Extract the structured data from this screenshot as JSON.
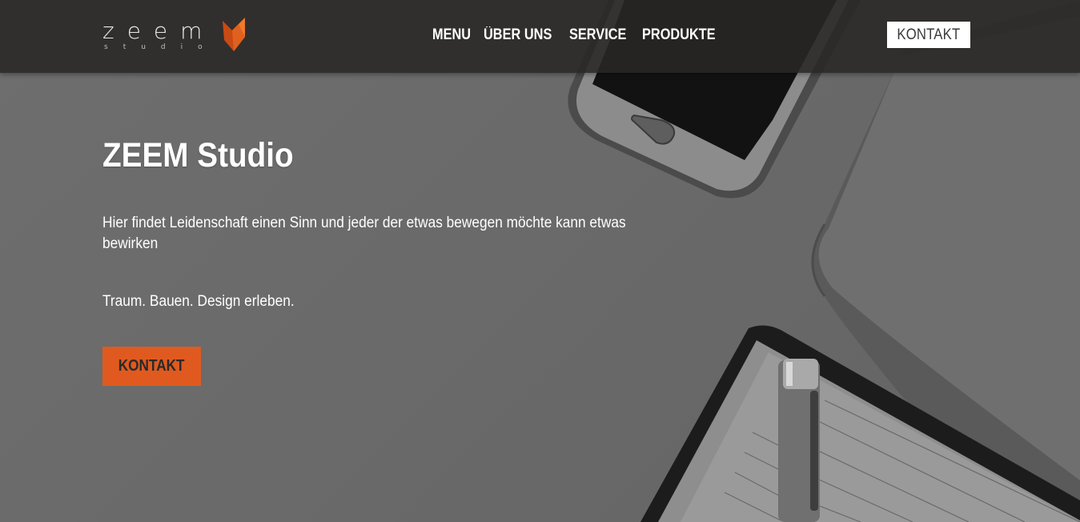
{
  "brand": {
    "name": "zeem",
    "subtitle": "studio",
    "accent_color": "#e05a1f"
  },
  "nav": {
    "items": [
      {
        "label": "MENU"
      },
      {
        "label": "ÜBER UNS"
      },
      {
        "label": "SERVICE"
      },
      {
        "label": "PRODUKTE"
      }
    ],
    "cta_label": "KONTAKT"
  },
  "hero": {
    "title": "ZEEM Studio",
    "lead": "Hier findet Leidenschaft einen Sinn und jeder der etwas bewegen möchte kann etwas bewirken",
    "tagline": "Traum. Bauen. Design erleben.",
    "cta_label": "KONTAKT",
    "background": "desk with smartphone, tablet, notebook and pen (grayscale)"
  },
  "colors": {
    "header_bg": "#282726",
    "cta_bg": "#e05a1f",
    "header_cta_bg": "#ffffff"
  }
}
